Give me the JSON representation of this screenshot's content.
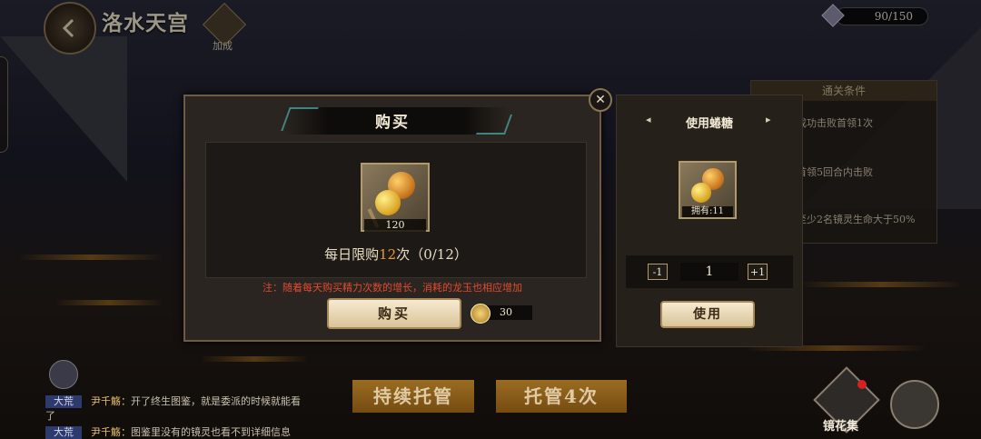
{
  "header": {
    "title": "洛水天宫",
    "bonus_label": "加成",
    "energy": "90/150"
  },
  "conditions_panel": {
    "title": "通关条件",
    "items": [
      "成功击败首领1次",
      "首领5回合内击败",
      "至少2名镜灵生命大于50%"
    ]
  },
  "purchase_modal": {
    "title": "购买",
    "item_quantity": "120",
    "limit_prefix": "每日限购",
    "limit_number": "12",
    "limit_suffix": "次（0/12）",
    "note": "注：随着每天购买精力次数的增长，消耗的龙玉也相应增加",
    "buy_label": "购买",
    "cost": "30",
    "close_symbol": "✕"
  },
  "use_panel": {
    "title": "使用蜷糖",
    "prev_arrow": "◂",
    "next_arrow": "▸",
    "owned": "拥有:11",
    "decrement": "-1",
    "quantity": "1",
    "increment": "+1",
    "use_label": "使用"
  },
  "bottom": {
    "auto_continue": "持续托管",
    "auto_four": "托管4次",
    "mirror_label": "镜花集"
  },
  "chat": [
    {
      "tag": "大荒",
      "name": "尹千觞：",
      "text": "开了终生图鉴，就是委派的时候就能看",
      "cont": "了"
    },
    {
      "tag": "大荒",
      "name": "尹千觞：",
      "text": "图鉴里没有的镜灵也看不到详细信息"
    }
  ],
  "colors": {
    "accent_gold": "#e39a3a",
    "note_red": "#e04a30",
    "button_cream": "#f6ead0"
  }
}
